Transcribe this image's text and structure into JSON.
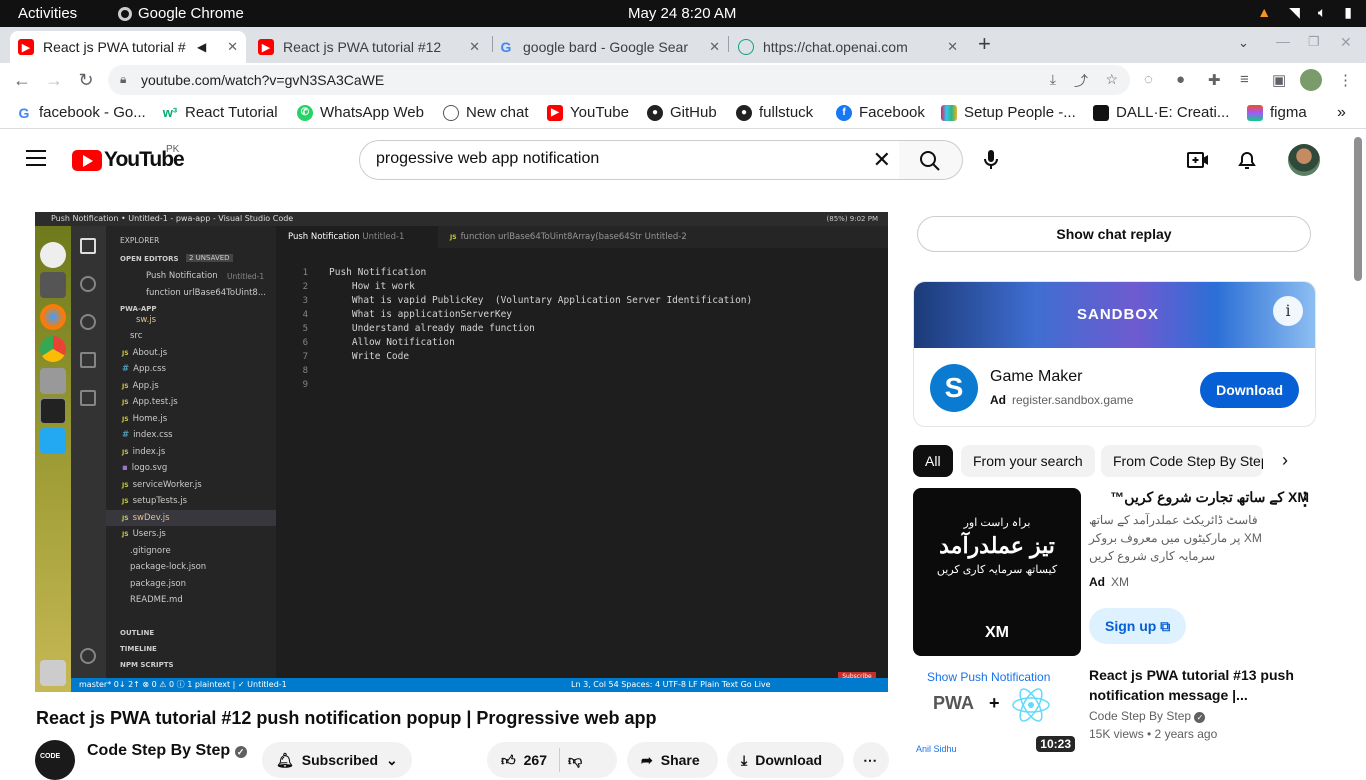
{
  "system": {
    "activities": "Activities",
    "app_name": "Google Chrome",
    "clock": "May 24  8:20 AM"
  },
  "tabs": [
    {
      "title": "React js PWA tutorial #",
      "icon": "youtube-icon"
    },
    {
      "title": "React js PWA tutorial #12",
      "icon": "youtube-icon"
    },
    {
      "title": "google bard - Google Sear",
      "icon": "google-icon"
    },
    {
      "title": "https://chat.openai.com",
      "icon": "chatgpt-icon"
    }
  ],
  "address": {
    "url": "youtube.com/watch?v=gvN3SA3CaWE"
  },
  "bookmarks": [
    "facebook - Go...",
    "React Tutorial",
    "WhatsApp Web",
    "New chat",
    "YouTube",
    "GitHub",
    "fullstuck",
    "Facebook",
    "Setup People -...",
    "DALL·E: Creati...",
    "figma"
  ],
  "youtube": {
    "logo_text": "YouTube",
    "country": "PK",
    "search_value": "progessive web app notification"
  },
  "video": {
    "os_title": "Push Notification • Untitled-1 - pwa-app - Visual Studio Code",
    "os_tray": "(85%)   9:02 PM",
    "explorer": "EXPLORER",
    "open_editors": "OPEN EDITORS",
    "unsaved": "2 UNSAVED",
    "open_file_1": "Push Notification",
    "open_file_1_sub": "Untitled-1",
    "open_file_2": "function urlBase64ToUint8...",
    "project": "PWA-APP",
    "files": [
      "sw.js",
      "src",
      "About.js",
      "App.css",
      "App.js",
      "App.test.js",
      "Home.js",
      "index.css",
      "index.js",
      "logo.svg",
      "serviceWorker.js",
      "setupTests.js",
      "swDev.js",
      "Users.js",
      ".gitignore",
      "package-lock.json",
      "package.json",
      "README.md"
    ],
    "sections": [
      "OUTLINE",
      "TIMELINE",
      "NPM SCRIPTS"
    ],
    "tab1": "Push Notification",
    "tab1_sub": "Untitled-1",
    "tab2": "function urlBase64ToUint8Array(base64Str",
    "tab2_sub": "Untitled-2",
    "code_lines": [
      "Push Notification",
      "    How it work",
      "    What is vapid PublicKey  (Voluntary Application Server Identification)",
      "    What is applicationServerKey",
      "    Understand already made function",
      "    Allow Notification",
      "    Write Code",
      "",
      ""
    ],
    "status_left": "master*   0↓ 2↑   ⊗ 0 ⚠ 0 ⓘ 1   plaintext | ✓ Untitled-1",
    "status_right": "Ln 3, Col 54    Spaces: 4    UTF-8    LF    Plain Text    Go Live",
    "subscribe_badge": "Subscribe"
  },
  "watch": {
    "title": "React js PWA tutorial #12 push notification popup | Progressive web app",
    "channel": "Code Step By Step",
    "subscribed": "Subscribed",
    "likes": "267",
    "share": "Share",
    "download": "Download"
  },
  "sidebar": {
    "chat_replay": "Show chat replay",
    "ad": {
      "banner_text": "SANDBOX",
      "title": "Game Maker",
      "ad_label": "Ad",
      "domain": "register.sandbox.game",
      "button": "Download"
    },
    "chips": [
      "All",
      "From your search",
      "From Code Step By Step"
    ],
    "promo": {
      "title": "XM کے ساتھ تجارت شروع کریں™",
      "desc": "فاسٹ ڈائریکٹ عملدرآمد کے ساتھ XM پر مارکیٹوں میں معروف بروکر سرمایہ کاری شروع کریں",
      "ad_label": "Ad",
      "advertiser": "XM",
      "button": "Sign up",
      "thumb_line1": "براہ راست اور",
      "thumb_line2": "تیز عملدرآمد",
      "thumb_line3": "کیساتھ سرمایہ کاری کریں",
      "thumb_logo": "XM"
    },
    "related": {
      "title": "React js PWA tutorial #13 push notification message |...",
      "channel": "Code Step By Step",
      "meta": "15K views • 2 years ago",
      "duration": "10:23",
      "thumb_caption": "Show Push Notification",
      "thumb_author": "Anil Sidhu",
      "thumb_label": "PWA"
    }
  }
}
